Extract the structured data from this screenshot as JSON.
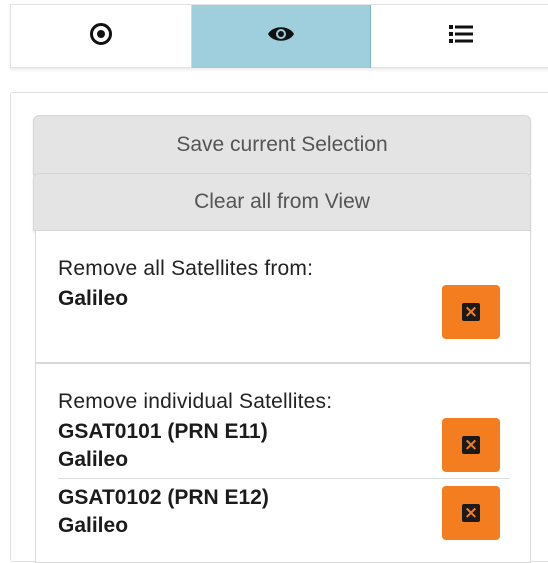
{
  "tabs": [
    {
      "icon": "target-icon",
      "active": false
    },
    {
      "icon": "eye-icon",
      "active": true
    },
    {
      "icon": "list-icon",
      "active": false
    }
  ],
  "actions": {
    "save_label": "Save current Selection",
    "clear_label": "Clear all from View"
  },
  "remove_all": {
    "label": "Remove all Satellites from:",
    "constellation": "Galileo"
  },
  "remove_individual": {
    "label": "Remove individual Satellites:",
    "items": [
      {
        "name": "GSAT0101 (PRN E11)",
        "constellation": "Galileo"
      },
      {
        "name": "GSAT0102 (PRN E12)",
        "constellation": "Galileo"
      }
    ]
  },
  "colors": {
    "active_tab": "#9fcedd",
    "remove_button": "#f47e1f",
    "gray_button": "#e4e4e4"
  }
}
